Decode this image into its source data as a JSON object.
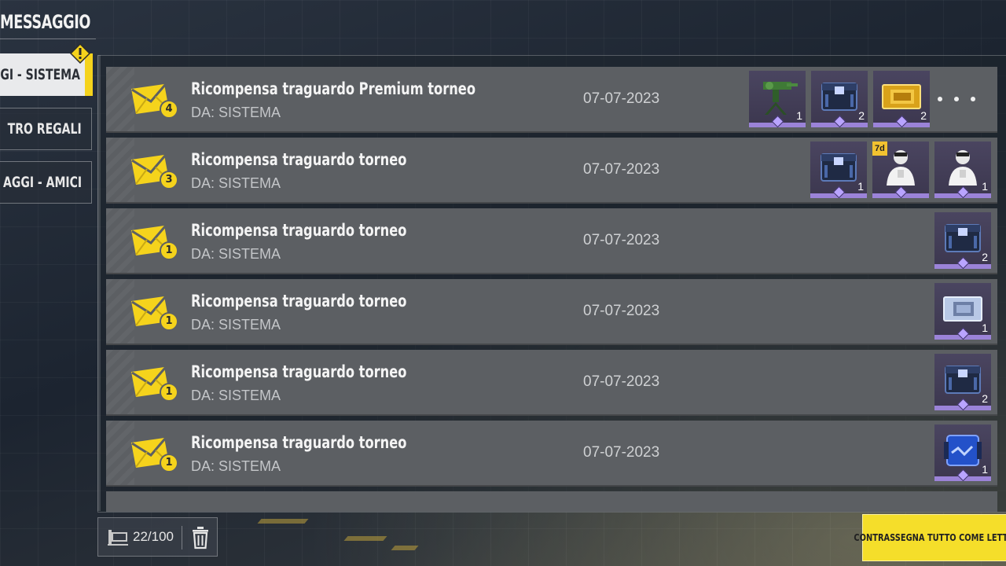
{
  "header": {
    "title": "MESSAGGIO"
  },
  "sidebar": {
    "tabs": [
      {
        "label": "GGI - SISTEMA",
        "active": true
      },
      {
        "label": "TRO REGALI",
        "active": false
      },
      {
        "label": "AGGI - AMICI",
        "active": false
      }
    ],
    "warning_icon": "warning-icon"
  },
  "messages": [
    {
      "title": "Ricompensa traguardo Premium torneo",
      "from": "DA: SISTEMA",
      "date": "07-07-2023",
      "count": "4",
      "rewards": [
        {
          "icon": "turret-icon",
          "qty": "1"
        },
        {
          "icon": "crate-icon",
          "qty": "2"
        },
        {
          "icon": "gold-ticket-icon",
          "qty": "2"
        }
      ],
      "has_more": true
    },
    {
      "title": "Ricompensa traguardo torneo",
      "from": "DA: SISTEMA",
      "date": "07-07-2023",
      "count": "3",
      "rewards": [
        {
          "icon": "crate-icon",
          "qty": "1"
        },
        {
          "icon": "soldier-icon",
          "qty": "",
          "tag": "7d"
        },
        {
          "icon": "soldier-icon",
          "qty": "1"
        }
      ],
      "has_more": false
    },
    {
      "title": "Ricompensa traguardo torneo",
      "from": "DA: SISTEMA",
      "date": "07-07-2023",
      "count": "1",
      "rewards": [
        {
          "icon": "crate-icon",
          "qty": "2"
        }
      ],
      "has_more": false
    },
    {
      "title": "Ricompensa traguardo torneo",
      "from": "DA: SISTEMA",
      "date": "07-07-2023",
      "count": "1",
      "rewards": [
        {
          "icon": "silver-ticket-icon",
          "qty": "1"
        }
      ],
      "has_more": false
    },
    {
      "title": "Ricompensa traguardo torneo",
      "from": "DA: SISTEMA",
      "date": "07-07-2023",
      "count": "1",
      "rewards": [
        {
          "icon": "crate-icon",
          "qty": "2"
        }
      ],
      "has_more": false
    },
    {
      "title": "Ricompensa traguardo torneo",
      "from": "DA: SISTEMA",
      "date": "07-07-2023",
      "count": "1",
      "rewards": [
        {
          "icon": "blue-case-icon",
          "qty": "1"
        }
      ],
      "has_more": false
    }
  ],
  "footer": {
    "capacity": "22/100",
    "mark_all_label": "CONTRASSEGNA TUTTO COME LETTO"
  },
  "colors": {
    "accent": "#f5de2a",
    "rarity": "#9b83d8",
    "row_bg": "#5c5f63"
  }
}
